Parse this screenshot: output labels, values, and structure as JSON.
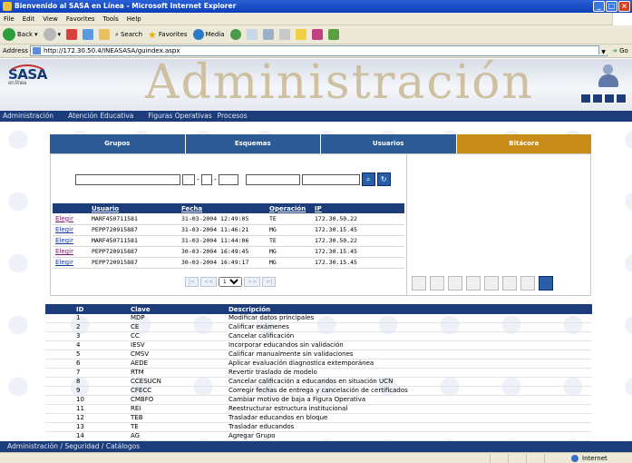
{
  "window": {
    "title": "Bienvenido al SASA en Línea - Microsoft Internet Explorer"
  },
  "menu": [
    "File",
    "Edit",
    "View",
    "Favorites",
    "Tools",
    "Help"
  ],
  "toolbar": {
    "back": "Back",
    "search": "Search",
    "favorites": "Favorites",
    "media": "Media"
  },
  "address": {
    "label": "Address",
    "url": "http://172.30.50.4/INEASASA/guindex.aspx",
    "go": "Go"
  },
  "header": {
    "logo": "SASA",
    "logo_sub": "en línea",
    "title": "Administración"
  },
  "nav": [
    "Administración",
    "Atención Educativa",
    "Figuras Operativas",
    "Procesos"
  ],
  "tabs": [
    "Grupos",
    "Esquemas",
    "Usuarios",
    "Bitácora"
  ],
  "active_tab": "Bitácora",
  "pager": {
    "page": "1",
    "first": "|<",
    "prev": "<<",
    "next": ">>",
    "last": ">|"
  },
  "log_table": {
    "columns": [
      "Usuario",
      "Fecha",
      "Operación",
      "IP"
    ],
    "rows": [
      {
        "link": "Elegir",
        "usuario": "MARF450711581",
        "fecha": "31-03-2004 12:49:05",
        "op": "TE",
        "ip": "172.30.50.22"
      },
      {
        "link": "Elegir",
        "usuario": "PEPP720915887",
        "fecha": "31-03-2004 11:46:21",
        "op": "MG",
        "ip": "172.30.15.45"
      },
      {
        "link": "Elegir",
        "usuario": "MARF450711581",
        "fecha": "31-03-2004 11:44:06",
        "op": "TE",
        "ip": "172.30.50.22"
      },
      {
        "link": "Elegir",
        "usuario": "PEPP720915887",
        "fecha": "30-03-2004 16:49:45",
        "op": "MG",
        "ip": "172.30.15.45"
      },
      {
        "link": "Elegir",
        "usuario": "PEPP720915887",
        "fecha": "30-03-2004 16:49:17",
        "op": "MG",
        "ip": "172.30.15.45"
      }
    ]
  },
  "catalog_table": {
    "columns": [
      "ID",
      "Clave",
      "Descripción"
    ],
    "rows": [
      {
        "id": "1",
        "clave": "MDP",
        "desc": "Modificar datos principales"
      },
      {
        "id": "2",
        "clave": "CE",
        "desc": "Calificar exámenes"
      },
      {
        "id": "3",
        "clave": "CC",
        "desc": "Cancelar calificación"
      },
      {
        "id": "4",
        "clave": "IESV",
        "desc": "Incorporar educandos sin validación"
      },
      {
        "id": "5",
        "clave": "CMSV",
        "desc": "Calificar manualmente sin validaciones"
      },
      {
        "id": "6",
        "clave": "AEDE",
        "desc": "Aplicar evaluación diagnostica extemporánea"
      },
      {
        "id": "7",
        "clave": "RTM",
        "desc": "Revertir traslado de modelo"
      },
      {
        "id": "8",
        "clave": "CCESUCN",
        "desc": "Cancelar calificación a educandos en situación UCN"
      },
      {
        "id": "9",
        "clave": "CFECC",
        "desc": "Corregir fechas de entrega y cancelación de certificados"
      },
      {
        "id": "10",
        "clave": "CMBFO",
        "desc": "Cambiar motivo de baja a Figura Operativa"
      },
      {
        "id": "11",
        "clave": "REI",
        "desc": "Reestructurar estructura institucional"
      },
      {
        "id": "12",
        "clave": "TEB",
        "desc": "Trasladar educandos en bloque"
      },
      {
        "id": "13",
        "clave": "TE",
        "desc": "Trasladar educandos"
      },
      {
        "id": "14",
        "clave": "AG",
        "desc": "Agregar Grupo"
      }
    ]
  },
  "footer": {
    "breadcrumb": "Administración / Seguridad / Catálogos"
  },
  "status": {
    "zone": "Internet"
  }
}
